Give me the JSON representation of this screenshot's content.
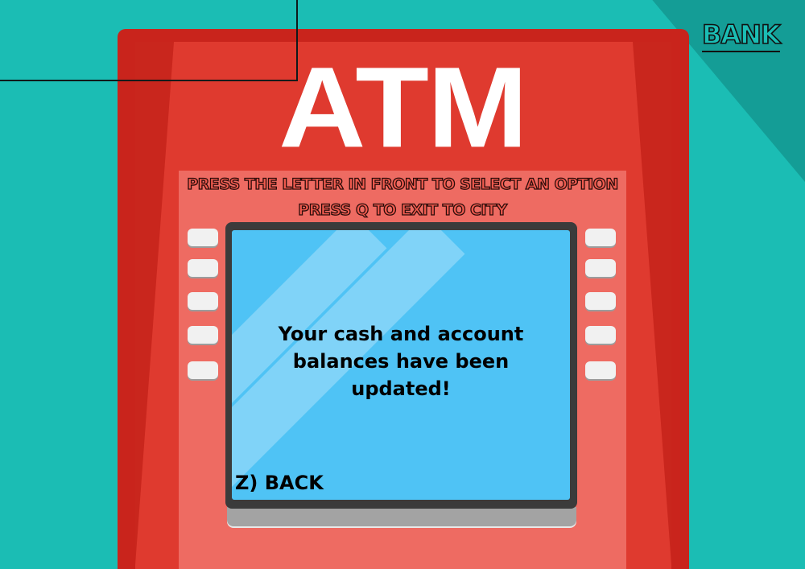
{
  "machine": {
    "logo_text": "ATM"
  },
  "instructions": {
    "line1": "PRESS THE LETTER IN FRONT TO SELECT AN OPTION",
    "line2": "PRESS Q TO EXIT TO CITY"
  },
  "screen": {
    "message": "Your cash and account balances have been updated!",
    "back_label": "Z) BACK"
  },
  "nav": {
    "bank_label": "BANK"
  },
  "colors": {
    "background": "#1bbdb4",
    "atm_red": "#df3a2f",
    "screen_blue": "#4fc3f5",
    "text_black": "#000000"
  }
}
